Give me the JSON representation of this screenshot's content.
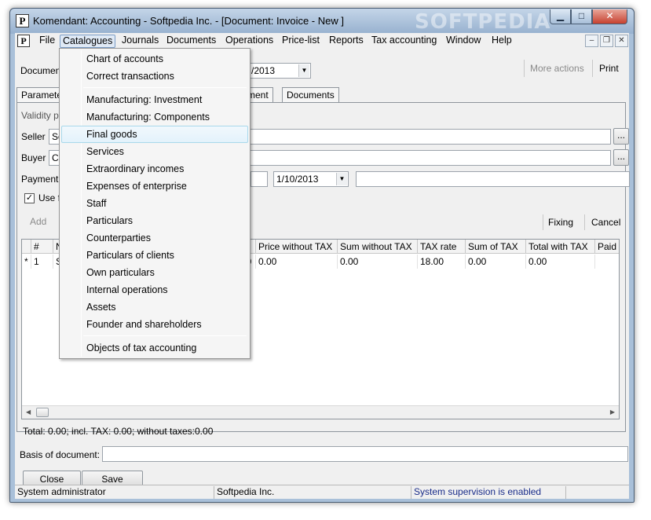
{
  "window": {
    "title": "Komendant: Accounting - Softpedia Inc. - [Document: Invoice - New ]",
    "watermark": "SOFTPEDIA",
    "min_glyph": "▁",
    "max_glyph": "□",
    "close_glyph": "✕"
  },
  "menubar": {
    "items": [
      "File",
      "Catalogues",
      "Journals",
      "Documents",
      "Operations",
      "Price-list",
      "Reports",
      "Tax accounting",
      "Window",
      "Help"
    ],
    "mdi_min": "–",
    "mdi_restore": "❐",
    "mdi_close": "✕"
  },
  "form": {
    "document_label": "Document",
    "date_value": "/2013",
    "more_actions": "More actions",
    "print": "Print",
    "tabs": [
      "Paramete",
      "ment",
      "Documents"
    ],
    "validity_label": "Validity pe",
    "seller_label": "Seller",
    "seller_value": "So",
    "buyer_label": "Buyer",
    "buyer_value": "Co",
    "payment_label": "Payment",
    "payment_date": "1/10/2013",
    "use_label": "Use fo",
    "browse_glyph": "...",
    "add_button": "Add",
    "fixing_button": "Fixing",
    "cancel_button": "Cancel",
    "total_text": "Total: 0.00; incl. TAX: 0.00; without taxes:0.00",
    "basis_label": "Basis of document:",
    "close_button": "Close",
    "save_button": "Save"
  },
  "grid": {
    "headers": [
      "#",
      "N",
      "Price without TAX",
      "Sum without TAX",
      "TAX rate",
      "Sum of TAX",
      "Total with TAX",
      "Paid"
    ],
    "row": {
      "marker": "*",
      "num": "1",
      "name": "S",
      "qty_tail": "00",
      "price": "0.00",
      "sum": "0.00",
      "rate": "18.00",
      "tax": "0.00",
      "total": "0.00"
    }
  },
  "dropdown": {
    "groups": [
      [
        "Chart of accounts",
        "Correct transactions"
      ],
      [
        "Manufacturing: Investment",
        "Manufacturing: Components",
        "Final goods",
        "Services",
        "Extraordinary incomes",
        "Expenses of enterprise",
        "Staff",
        "Particulars",
        "Counterparties",
        "Particulars of clients",
        "Own particulars",
        "Internal operations",
        "Assets",
        "Founder and shareholders"
      ],
      [
        "Objects of tax accounting"
      ]
    ],
    "highlighted": "Final goods"
  },
  "statusbar": {
    "user": "System administrator",
    "company": "Softpedia Inc.",
    "supervision": "System supervision is enabled"
  },
  "colors": {
    "supervision_text": "#1a2d8a"
  }
}
